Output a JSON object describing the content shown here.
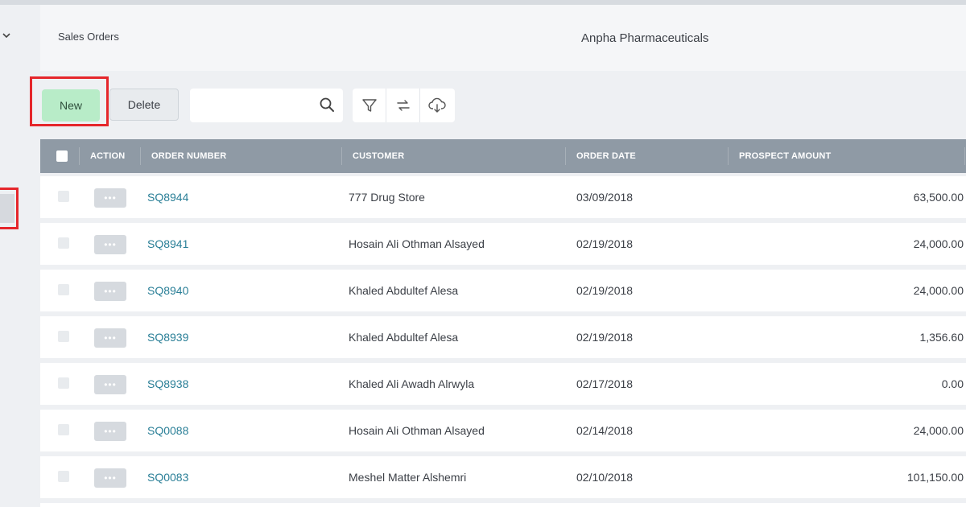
{
  "header": {
    "module_title": "Sales Orders",
    "company_name": "Anpha Pharmaceuticals"
  },
  "toolbar": {
    "new_label": "New",
    "delete_label": "Delete",
    "search_placeholder": ""
  },
  "icons": {
    "collapse": "chevron-down-icon",
    "search": "search-icon",
    "filter": "filter-icon",
    "refresh": "refresh-icon",
    "download": "cloud-download-icon",
    "action": "more-icon"
  },
  "table": {
    "columns": {
      "action": "ACTION",
      "order_number": "ORDER NUMBER",
      "customer": "CUSTOMER",
      "order_date": "ORDER DATE",
      "prospect_amount": "PROSPECT AMOUNT"
    },
    "action_glyph": "•••",
    "rows": [
      {
        "order_number": "SQ8944",
        "customer": "777 Drug Store",
        "order_date": "03/09/2018",
        "amount": "63,500.00"
      },
      {
        "order_number": "SQ8941",
        "customer": "Hosain Ali Othman Alsayed",
        "order_date": "02/19/2018",
        "amount": "24,000.00"
      },
      {
        "order_number": "SQ8940",
        "customer": "Khaled Abdultef Alesa",
        "order_date": "02/19/2018",
        "amount": "24,000.00"
      },
      {
        "order_number": "SQ8939",
        "customer": "Khaled Abdultef Alesa",
        "order_date": "02/19/2018",
        "amount": "1,356.60"
      },
      {
        "order_number": "SQ8938",
        "customer": "Khaled Ali Awadh Alrwyla",
        "order_date": "02/17/2018",
        "amount": "0.00"
      },
      {
        "order_number": "SQ0088",
        "customer": "Hosain Ali Othman Alsayed",
        "order_date": "02/14/2018",
        "amount": "24,000.00"
      },
      {
        "order_number": "SQ0083",
        "customer": "Meshel Matter Alshemri",
        "order_date": "02/10/2018",
        "amount": "101,150.00"
      }
    ]
  },
  "colors": {
    "new_button": "#b8ecc8",
    "table_header": "#8f9aa5",
    "order_link": "#2a7f97",
    "highlight": "#e5262b"
  }
}
